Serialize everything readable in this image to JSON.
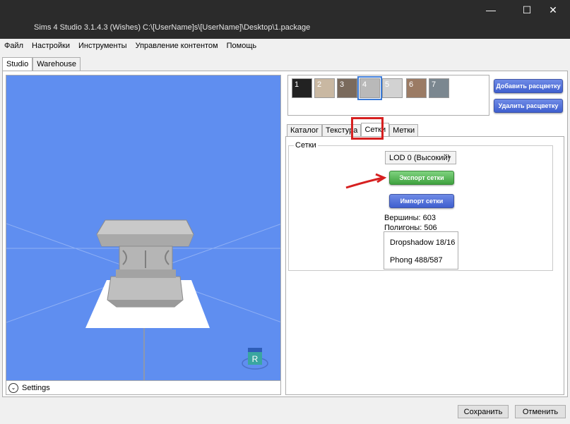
{
  "window": {
    "title": "Sims 4 Studio 3.1.4.3 (Wishes)  C:\\[UserName]s\\[UserName]\\Desktop\\1.package",
    "min_icon": "minimize-icon",
    "max_icon": "maximize-icon",
    "close_icon": "close-icon"
  },
  "menu": [
    "Файл",
    "Настройки",
    "Инструменты",
    "Управление контентом",
    "Помощь"
  ],
  "top_tabs": [
    "Studio",
    "Warehouse"
  ],
  "viewport": {
    "background": "#5f8ef0",
    "settings_label": "Settings",
    "badge_letter": "R"
  },
  "swatches": [
    {
      "label": "1",
      "color": "#222222"
    },
    {
      "label": "2",
      "color": "#c9b8a2"
    },
    {
      "label": "3",
      "color": "#7a6a5c"
    },
    {
      "label": "4",
      "color": "#b9b9b9"
    },
    {
      "label": "5",
      "color": "#d2d2d2"
    },
    {
      "label": "6",
      "color": "#9b7b64"
    },
    {
      "label": "7",
      "color": "#7b8790"
    }
  ],
  "buttons": {
    "add_swatch": "Добавить расцветку",
    "remove_swatch": "Удалить расцветку",
    "export_mesh": "Экспорт сетки",
    "import_mesh": "Импорт сетки",
    "save": "Сохранить",
    "cancel": "Отменить"
  },
  "sub_tabs": [
    "Каталог",
    "Текстура",
    "Сетки",
    "Метки"
  ],
  "meshes": {
    "group_label": "Сетки",
    "lod_value": "LOD 0 (Высокий)",
    "vertices": "Вершины:  603",
    "polygons": "Полигоны: 506",
    "list": [
      "Dropshadow 18/16",
      "Phong 488/587"
    ]
  }
}
